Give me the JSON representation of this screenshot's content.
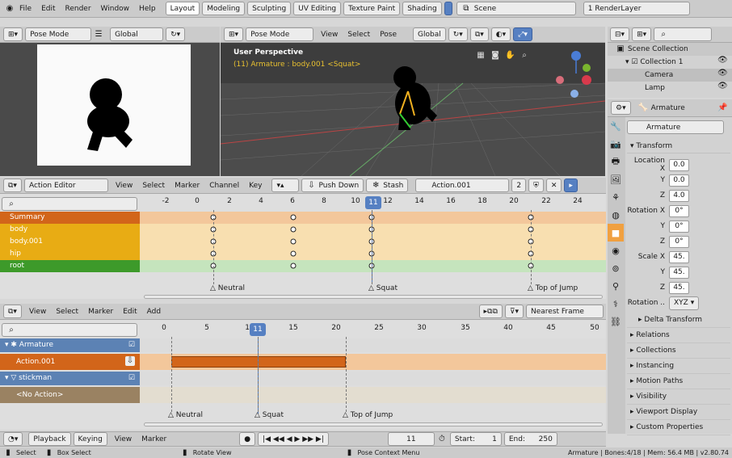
{
  "topbar": {
    "menus": [
      "File",
      "Edit",
      "Render",
      "Window",
      "Help"
    ],
    "workspaces": [
      "Layout",
      "Modeling",
      "Sculpting",
      "UV Editing",
      "Texture Paint",
      "Shading"
    ],
    "scene": "Scene",
    "renderlayer": "1 RenderLayer"
  },
  "left_header": {
    "mode": "Pose Mode",
    "orientation": "Global"
  },
  "viewport": {
    "mode": "Pose Mode",
    "menus": [
      "View",
      "Select",
      "Pose"
    ],
    "orientation": "Global",
    "title": "User Perspective",
    "subtitle": "(11) Armature : body.001 <Squat>"
  },
  "outliner": {
    "root": "Scene Collection",
    "items": [
      "Collection 1",
      "Camera",
      "Lamp"
    ]
  },
  "props": {
    "object": "Armature",
    "data": "Armature",
    "section": "Transform",
    "loc": [
      "0.0",
      "0.0",
      "4.0"
    ],
    "rot": [
      "0°",
      "0°",
      "0°"
    ],
    "scale": [
      "45.",
      "45.",
      "45."
    ],
    "axes": [
      "X",
      "Y",
      "Z"
    ],
    "labels": {
      "loc": "Location X",
      "rot": "Rotation X",
      "scale": "Scale X",
      "mode": "Rotation ..",
      "mode_val": "XYZ"
    },
    "subsections": [
      "Delta Transform",
      "Relations",
      "Collections",
      "Instancing",
      "Motion Paths",
      "Visibility",
      "Viewport Display",
      "Custom Properties"
    ]
  },
  "action_editor": {
    "mode": "Action Editor",
    "menus": [
      "View",
      "Select",
      "Marker",
      "Channel",
      "Key"
    ],
    "push_down": "Push Down",
    "stash": "Stash",
    "action": "Action.001",
    "users": "2",
    "ticks": [
      "-2",
      "0",
      "2",
      "4",
      "6",
      "8",
      "10",
      "12",
      "14",
      "16",
      "18",
      "20",
      "22",
      "24"
    ],
    "current": "11",
    "channels": [
      "Summary",
      "body",
      "body.001",
      "hip",
      "root"
    ],
    "markers": [
      "Neutral",
      "Squat",
      "Top of Jump"
    ]
  },
  "nla": {
    "menus": [
      "View",
      "Select",
      "Marker",
      "Edit",
      "Add"
    ],
    "snap": "Nearest Frame",
    "ticks": [
      "0",
      "5",
      "10",
      "15",
      "20",
      "25",
      "30",
      "35",
      "40",
      "45",
      "50"
    ],
    "current": "11",
    "tracks": [
      "Armature",
      "Action.001",
      "stickman",
      "<No Action>"
    ],
    "markers": [
      "Neutral",
      "Squat",
      "Top of Jump"
    ]
  },
  "playback": {
    "menus": [
      "Playback",
      "Keying",
      "View",
      "Marker"
    ],
    "frame": "11",
    "start_label": "Start:",
    "start": "1",
    "end_label": "End:",
    "end": "250"
  },
  "status": {
    "left": [
      "Select",
      "Box Select",
      "Rotate View",
      "Pose Context Menu"
    ],
    "right": "Armature | Bones:4/18 | Mem: 56.4 MB | v2.80.74"
  }
}
